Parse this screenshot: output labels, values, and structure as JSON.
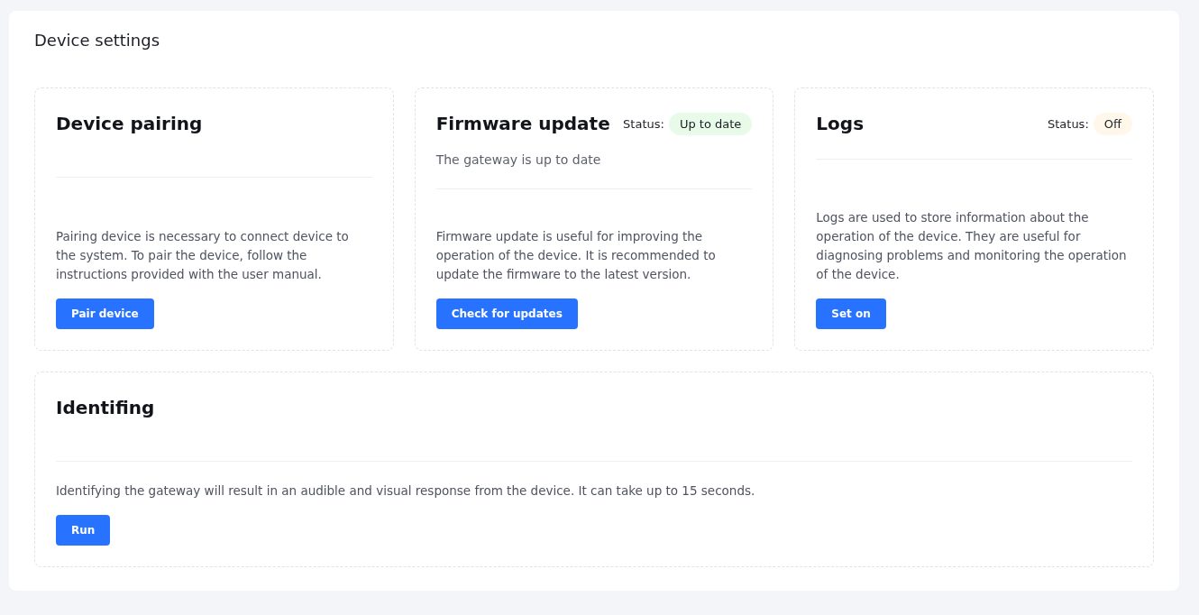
{
  "page": {
    "title": "Device settings"
  },
  "cards": [
    {
      "title": "Device pairing",
      "description": "Pairing device is necessary to connect device to the system. To pair the device, follow the instructions provided with the user manual.",
      "button": "Pair device"
    },
    {
      "title": "Firmware update",
      "status": {
        "label": "Status:",
        "value": "Up to date",
        "color": "#e8fbe8"
      },
      "subtitle": "The gateway is up to date",
      "description": "Firmware update is useful for improving the operation of the device. It is recommended to update the firmware to the latest version.",
      "button": "Check for updates"
    },
    {
      "title": "Logs",
      "status": {
        "label": "Status:",
        "value": "Off",
        "color": "#fff7ea"
      },
      "description": "Logs are used to store information about the operation of the device. They are useful for diagnosing problems and monitoring the operation of the device.",
      "button": "Set on"
    },
    {
      "title": "Identifing",
      "description": "Identifying the gateway will result in an audible and visual response from the device. It can take up to 15 seconds.",
      "button": "Run"
    }
  ]
}
